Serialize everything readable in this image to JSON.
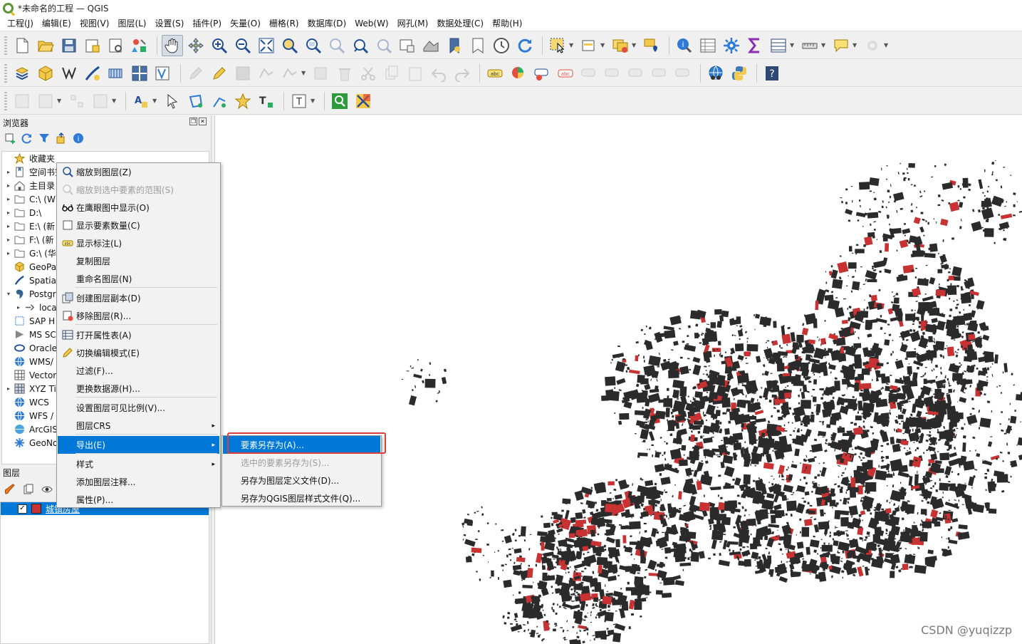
{
  "window": {
    "title": "*未命名的工程 — QGIS"
  },
  "menubar": [
    "工程(J)",
    "编辑(E)",
    "视图(V)",
    "图层(L)",
    "设置(S)",
    "插件(P)",
    "矢量(O)",
    "栅格(R)",
    "数据库(D)",
    "Web(W)",
    "网孔(M)",
    "数据处理(C)",
    "帮助(H)"
  ],
  "browser": {
    "title": "浏览器",
    "items": [
      {
        "label": "收藏夹",
        "icon": "star-icon",
        "expand": ""
      },
      {
        "label": "空间书签",
        "icon": "bookmark-icon",
        "expand": "▸"
      },
      {
        "label": "主目录",
        "icon": "home-folder-icon",
        "expand": "▸"
      },
      {
        "label": "C:\\ (W",
        "icon": "folder-icon",
        "expand": "▸"
      },
      {
        "label": "D:\\",
        "icon": "folder-icon",
        "expand": "▸"
      },
      {
        "label": "E:\\ (新",
        "icon": "folder-icon",
        "expand": "▸"
      },
      {
        "label": "F:\\ (新",
        "icon": "folder-icon",
        "expand": "▸"
      },
      {
        "label": "G:\\ (华",
        "icon": "folder-icon",
        "expand": "▸"
      },
      {
        "label": "GeoPa",
        "icon": "geopackage-icon",
        "expand": ""
      },
      {
        "label": "Spatia",
        "icon": "spatialite-icon",
        "expand": ""
      },
      {
        "label": "Postgr",
        "icon": "postgres-icon",
        "expand": "▾"
      },
      {
        "label": "loca",
        "icon": "connection-icon",
        "expand": "▸",
        "indent": true
      },
      {
        "label": "SAP H",
        "icon": "sap-icon",
        "expand": ""
      },
      {
        "label": "MS SC",
        "icon": "mssql-icon",
        "expand": ""
      },
      {
        "label": "Oracle",
        "icon": "oracle-icon",
        "expand": ""
      },
      {
        "label": "WMS/",
        "icon": "wms-icon",
        "expand": ""
      },
      {
        "label": "Vector",
        "icon": "vector-tile-icon",
        "expand": ""
      },
      {
        "label": "XYZ Ti",
        "icon": "xyz-tile-icon",
        "expand": "▸"
      },
      {
        "label": "WCS",
        "icon": "wcs-icon",
        "expand": ""
      },
      {
        "label": "WFS /",
        "icon": "wfs-icon",
        "expand": ""
      },
      {
        "label": "ArcGIS",
        "icon": "arcgis-icon",
        "expand": ""
      },
      {
        "label": "GeoNo",
        "icon": "geonode-icon",
        "expand": ""
      }
    ]
  },
  "layers": {
    "title": "图层",
    "items": [
      {
        "name": "城镇房屋",
        "checked": true,
        "color": "#c83232"
      }
    ]
  },
  "context_menu": {
    "items": [
      {
        "label": "缩放到图层(Z)",
        "icon": "zoom-layer-icon",
        "disabled": false
      },
      {
        "label": "缩放到选中要素的范围(S)",
        "icon": "zoom-selection-icon",
        "disabled": true
      },
      {
        "label": "在鹰眼图中显示(O)",
        "icon": "overview-icon",
        "disabled": false
      },
      {
        "label": "显示要素数量(C)",
        "icon": "checkbox-icon",
        "disabled": false
      },
      {
        "label": "显示标注(L)",
        "icon": "label-icon",
        "disabled": false
      },
      {
        "label": "复制图层",
        "icon": "",
        "disabled": false
      },
      {
        "label": "重命名图层(N)",
        "icon": "",
        "disabled": false
      },
      {
        "label": "创建图层副本(D)",
        "icon": "duplicate-icon",
        "disabled": false
      },
      {
        "label": "移除图层(R)...",
        "icon": "remove-layer-icon",
        "disabled": false
      },
      {
        "label": "打开属性表(A)",
        "icon": "attribute-table-icon",
        "disabled": false
      },
      {
        "label": "切换编辑模式(E)",
        "icon": "pencil-icon",
        "disabled": false
      },
      {
        "label": "过滤(F)...",
        "icon": "",
        "disabled": false
      },
      {
        "label": "更换数据源(H)...",
        "icon": "",
        "disabled": false
      },
      {
        "label": "设置图层可见比例(V)...",
        "icon": "",
        "disabled": false
      },
      {
        "label": "图层CRS",
        "icon": "",
        "disabled": false,
        "submenu": true
      },
      {
        "label": "导出(E)",
        "icon": "",
        "disabled": false,
        "submenu": true,
        "highlight": true
      },
      {
        "label": "样式",
        "icon": "",
        "disabled": false,
        "submenu": true
      },
      {
        "label": "添加图层注释...",
        "icon": "",
        "disabled": false
      },
      {
        "label": "属性(P)...",
        "icon": "",
        "disabled": false
      }
    ],
    "arrow": "▸"
  },
  "export_submenu": {
    "items": [
      {
        "label": "要素另存为(A)...",
        "highlight": true,
        "disabled": false
      },
      {
        "label": "选中的要素另存为(S)...",
        "highlight": false,
        "disabled": true
      },
      {
        "label": "另存为图层定义文件(D)...",
        "highlight": false,
        "disabled": false
      },
      {
        "label": "另存为QGIS图层样式文件(Q)...",
        "highlight": false,
        "disabled": false
      }
    ]
  },
  "map": {
    "watermark": "CSDN @yuqizzp",
    "feature_color": "#2b2b2b",
    "selected_color": "#c83232"
  },
  "colors": {
    "accent": "#0078d7",
    "callout": "#e03c3c"
  }
}
